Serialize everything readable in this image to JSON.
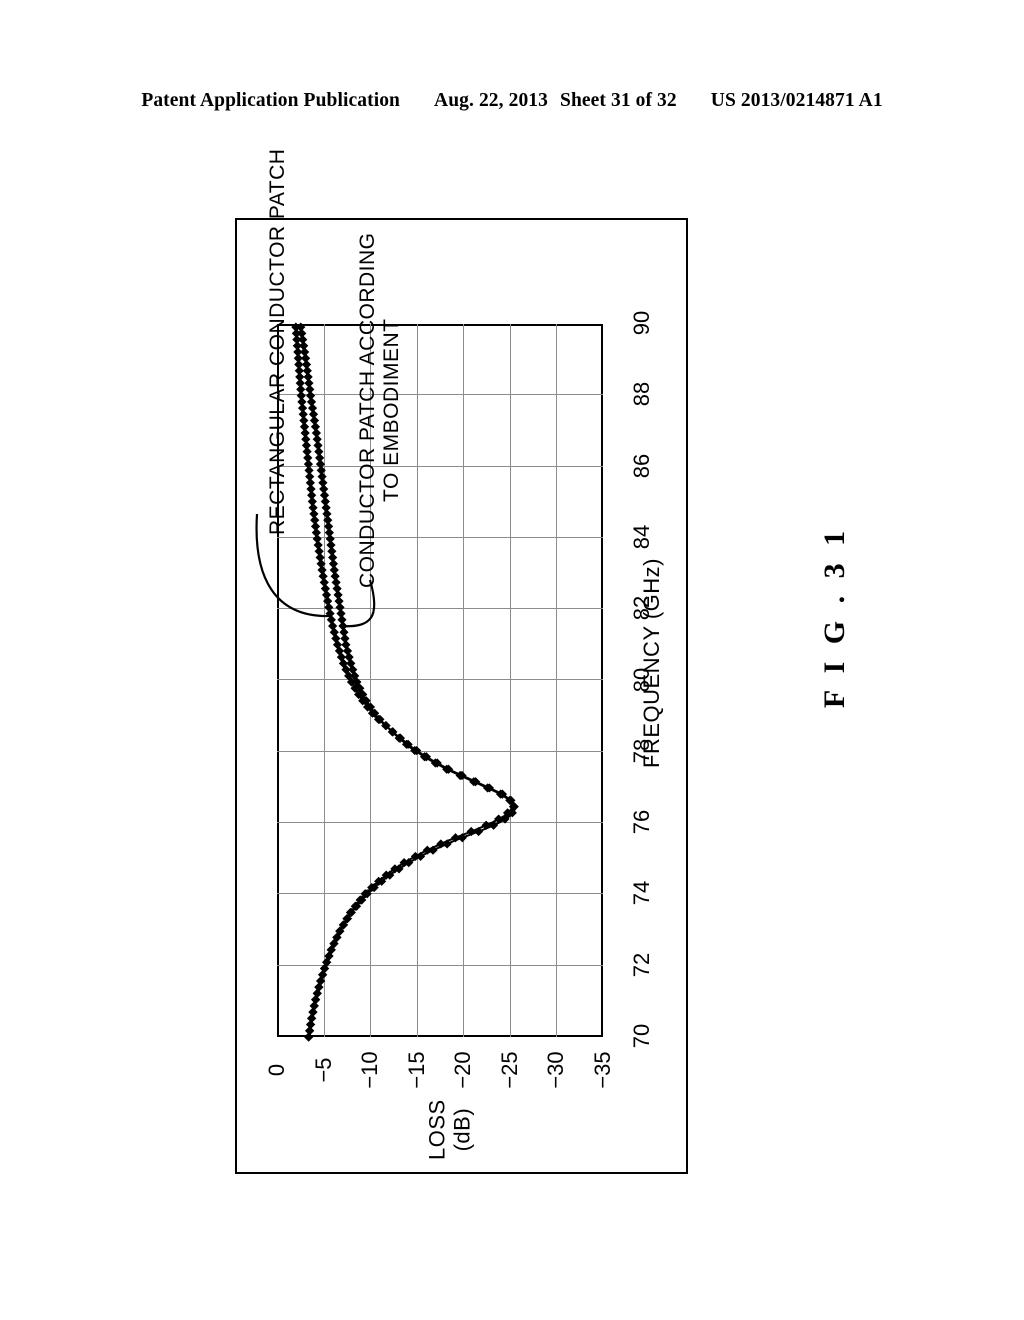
{
  "header": {
    "publication": "Patent Application Publication",
    "date": "Aug. 22, 2013",
    "sheet": "Sheet 31 of 32",
    "doc_number": "US 2013/0214871 A1"
  },
  "figure": {
    "caption": "F I G .  3 1"
  },
  "annotations": {
    "rectangular_patch": "RECTANGULAR CONDUCTOR PATCH",
    "embodiment_patch_line1": "CONDUCTOR PATCH ACCORDING",
    "embodiment_patch_line2": "TO EMBODIMENT"
  },
  "chart_data": {
    "type": "line",
    "title": "",
    "orientation": "rotated-90",
    "xlabel": "FREQUENCY (GHz)",
    "ylabel_line1": "LOSS",
    "ylabel_line2": "(dB)",
    "xlim": [
      70,
      90
    ],
    "ylim": [
      -35,
      0
    ],
    "xticks": [
      70,
      72,
      74,
      76,
      78,
      80,
      82,
      84,
      86,
      88,
      90
    ],
    "yticks": [
      0,
      -5,
      -10,
      -15,
      -20,
      -25,
      -30,
      -35
    ],
    "ytick_labels": [
      "0",
      "−5",
      "−10",
      "−15",
      "−20",
      "−25",
      "−30",
      "−35"
    ],
    "grid": true,
    "legend_position": "callout-annotations",
    "series": [
      {
        "name": "RECTANGULAR CONDUCTOR PATCH",
        "marker": "diamond",
        "color": "#000000",
        "x": [
          70.0,
          70.5,
          71.0,
          71.5,
          72.0,
          72.5,
          73.0,
          73.5,
          74.0,
          74.3,
          74.6,
          74.9,
          75.2,
          75.5,
          75.8,
          76.0,
          76.2,
          76.4,
          76.5,
          76.6,
          76.8,
          77.0,
          77.2,
          77.5,
          77.8,
          78.1,
          78.5,
          79.0,
          79.5,
          80.0,
          80.5,
          81.0,
          81.5,
          82.0,
          83.0,
          84.0,
          85.0,
          86.0,
          87.0,
          88.0,
          89.0,
          90.0
        ],
        "y": [
          -3.4,
          -3.7,
          -4.1,
          -4.6,
          -5.2,
          -5.9,
          -6.8,
          -7.9,
          -9.4,
          -10.6,
          -12.0,
          -13.7,
          -15.8,
          -18.3,
          -21.2,
          -23.0,
          -24.4,
          -25.2,
          -25.5,
          -25.3,
          -24.3,
          -22.7,
          -21.0,
          -18.5,
          -16.4,
          -14.6,
          -12.7,
          -10.5,
          -9.0,
          -7.9,
          -7.1,
          -6.5,
          -6.0,
          -5.6,
          -4.9,
          -4.3,
          -3.8,
          -3.4,
          -3.0,
          -2.6,
          -2.3,
          -2.0
        ]
      },
      {
        "name": "CONDUCTOR PATCH ACCORDING TO EMBODIMENT",
        "marker": "diamond",
        "color": "#000000",
        "x": [
          70.0,
          70.5,
          71.0,
          71.5,
          72.0,
          72.5,
          73.0,
          73.5,
          74.0,
          74.3,
          74.6,
          74.9,
          75.2,
          75.5,
          75.8,
          76.0,
          76.2,
          76.4,
          76.6,
          76.8,
          77.0,
          77.2,
          77.5,
          77.8,
          78.1,
          78.5,
          79.0,
          79.5,
          80.0,
          80.5,
          81.0,
          81.5,
          82.0,
          83.0,
          84.0,
          85.0,
          86.0,
          87.0,
          88.0,
          89.0,
          90.0
        ],
        "y": [
          -3.4,
          -3.7,
          -4.1,
          -4.6,
          -5.2,
          -5.9,
          -6.8,
          -8.0,
          -9.6,
          -10.9,
          -12.4,
          -14.2,
          -16.4,
          -19.0,
          -22.0,
          -23.8,
          -25.0,
          -25.6,
          -25.2,
          -24.1,
          -22.5,
          -20.8,
          -18.3,
          -16.2,
          -14.4,
          -12.6,
          -10.7,
          -9.4,
          -8.5,
          -7.9,
          -7.4,
          -7.1,
          -6.8,
          -6.2,
          -5.7,
          -5.2,
          -4.7,
          -4.2,
          -3.6,
          -3.1,
          -2.5
        ]
      }
    ]
  }
}
